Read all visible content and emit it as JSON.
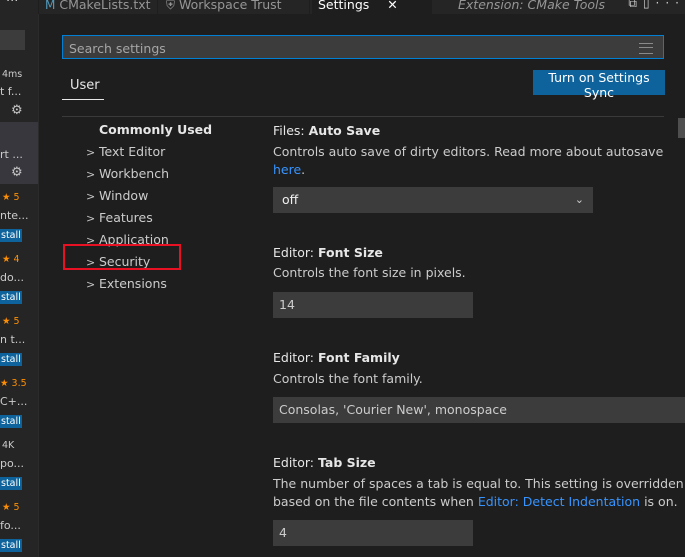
{
  "tabs": {
    "left_dots": "···",
    "cmake": {
      "icon": "M",
      "label": "CMakeLists.txt"
    },
    "trust": {
      "icon": "⛨",
      "label": "Workspace Trust"
    },
    "settings": {
      "label": "Settings",
      "close": "✕"
    },
    "ext": {
      "label": "Extension: CMake Tools"
    },
    "actions": "⧉▯···"
  },
  "left_strip": {
    "items": [
      {
        "text": "4ms"
      },
      {
        "text": "t f..."
      },
      {
        "text": "rt ..."
      },
      {
        "rating": "★ 5",
        "text": "nte...",
        "btn": "stall"
      },
      {
        "rating": "★ 4",
        "text": "do...",
        "btn": "stall"
      },
      {
        "rating": "★ 5",
        "text": "n t...",
        "btn": "stall"
      },
      {
        "rating": "★ 3.5",
        "text": "C+...",
        "btn": "stall"
      },
      {
        "rating": "4K",
        "text": "po...",
        "btn": "stall"
      },
      {
        "rating": "★ 5",
        "text": "fo...",
        "btn": "stall"
      }
    ]
  },
  "search": {
    "placeholder": "Search settings"
  },
  "scope_tab": "User",
  "sync_button": "Turn on Settings Sync",
  "toc": {
    "commonly_used": "Commonly Used",
    "items": [
      "Text Editor",
      "Workbench",
      "Window",
      "Features",
      "Application",
      "Security",
      "Extensions"
    ]
  },
  "settings": {
    "auto_save": {
      "category": "Files: ",
      "name": "Auto Save",
      "desc": "Controls auto save of dirty editors. Read more about autosave",
      "link": "here",
      "after_link": ".",
      "value": "off"
    },
    "font_size": {
      "category": "Editor: ",
      "name": "Font Size",
      "desc": "Controls the font size in pixels.",
      "value": "14"
    },
    "font_family": {
      "category": "Editor: ",
      "name": "Font Family",
      "desc": "Controls the font family.",
      "value": "Consolas, 'Courier New', monospace"
    },
    "tab_size": {
      "category": "Editor: ",
      "name": "Tab Size",
      "desc1": "The number of spaces a tab is equal to. This setting is overridden",
      "desc2_pre": "based on the file contents when ",
      "desc2_link": "Editor: Detect Indentation",
      "desc2_post": " is on.",
      "value": "4"
    }
  },
  "colors": {
    "accent": "#0e639c",
    "link": "#3794ff",
    "highlight": "#e81123",
    "star": "#ff8e00"
  }
}
